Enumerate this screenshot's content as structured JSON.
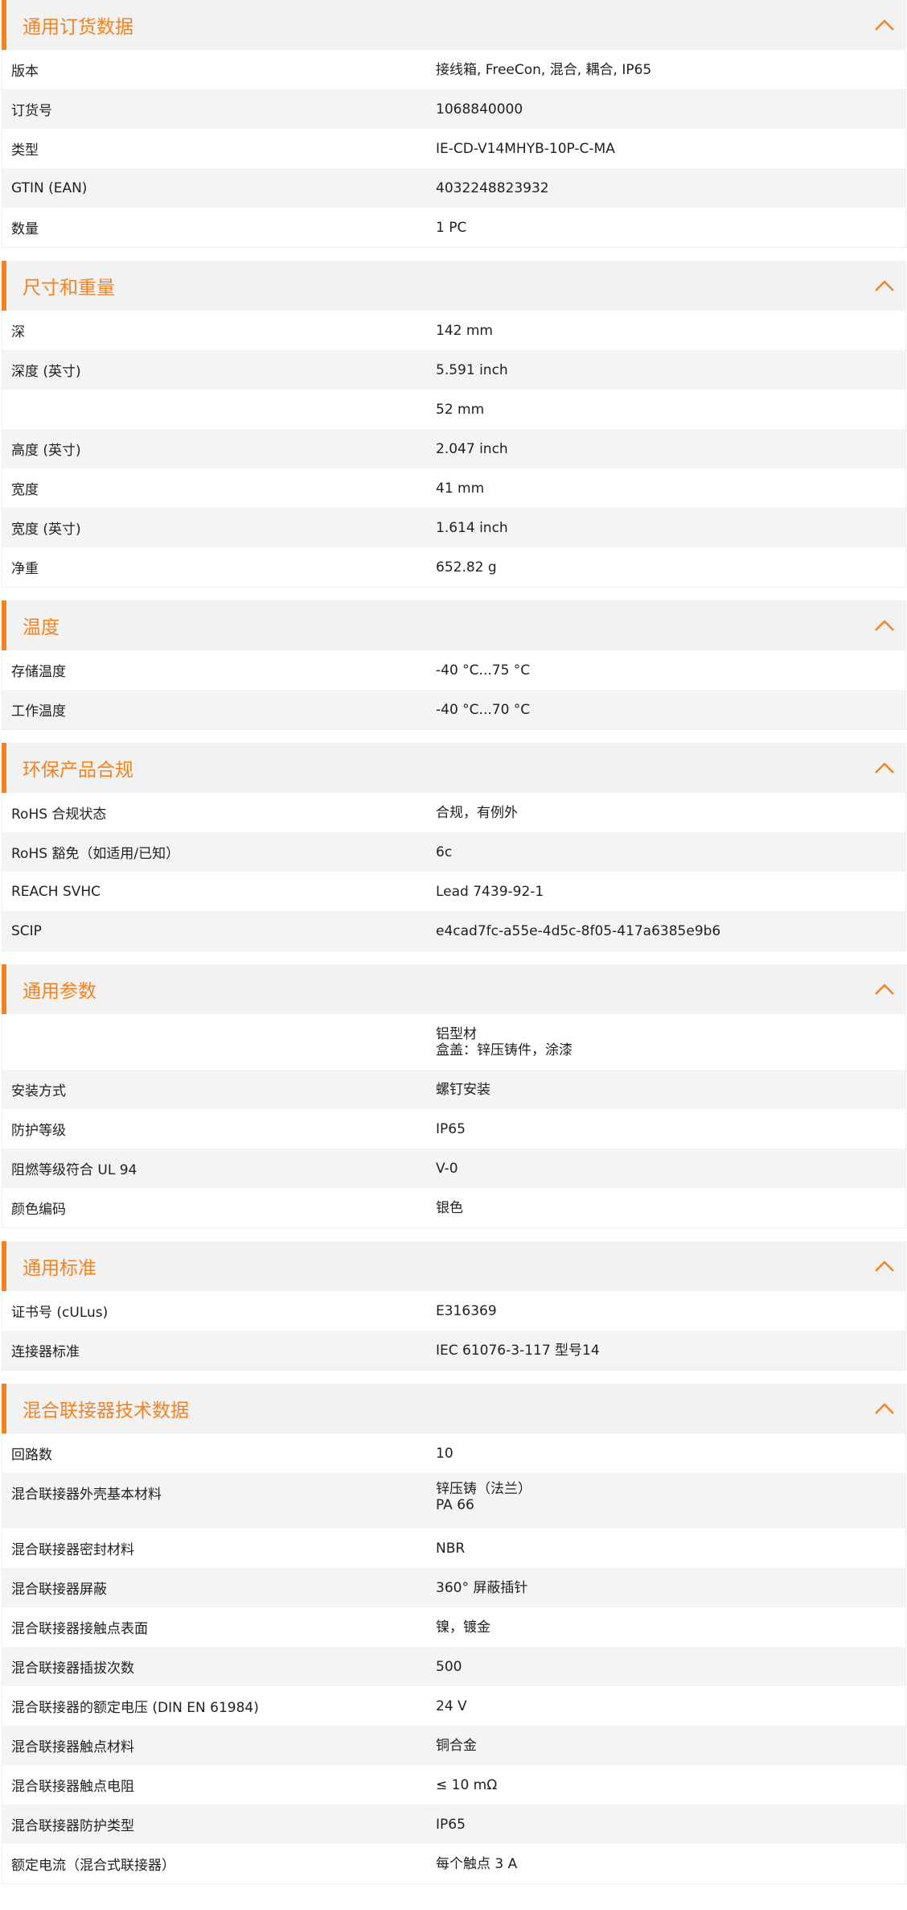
{
  "sections": [
    {
      "title": "通用订货数据",
      "rows": [
        {
          "label": "版本",
          "value": "接线箱, FreeCon, 混合, 耦合, IP65"
        },
        {
          "label": "订货号",
          "value": "1068840000"
        },
        {
          "label": "类型",
          "value": "IE-CD-V14MHYB-10P-C-MA"
        },
        {
          "label": "GTIN (EAN)",
          "value": "4032248823932"
        },
        {
          "label": "数量",
          "value": "1  PC"
        }
      ]
    },
    {
      "title": "尺寸和重量",
      "rows": [
        {
          "label": "深",
          "value": "142  mm"
        },
        {
          "label": "深度 (英寸)",
          "value": "5.591  inch"
        },
        {
          "label": "",
          "value": "52  mm"
        },
        {
          "label": "高度 (英寸)",
          "value": "2.047  inch"
        },
        {
          "label": "宽度",
          "value": "41  mm"
        },
        {
          "label": "宽度 (英寸)",
          "value": "1.614  inch"
        },
        {
          "label": "净重",
          "value": "652.82  g"
        }
      ]
    },
    {
      "title": "温度",
      "rows": [
        {
          "label": "存储温度",
          "value": "-40 °C...75 °C"
        },
        {
          "label": "工作温度",
          "value": "-40 °C...70 °C"
        }
      ]
    },
    {
      "title": "环保产品合规",
      "rows": [
        {
          "label": "RoHS 合规状态",
          "value": "合规，有例外"
        },
        {
          "label": "RoHS 豁免（如适用/已知）",
          "value": "6c"
        },
        {
          "label": "REACH SVHC",
          "value": "Lead 7439-92-1"
        },
        {
          "label": "SCIP",
          "value": "e4cad7fc-a55e-4d5c-8f05-417a6385e9b6"
        }
      ]
    },
    {
      "title": "通用参数",
      "rows": [
        {
          "label": "",
          "value": "铝型材",
          "value2": "盒盖：锌压铸件，涂漆"
        },
        {
          "label": "安装方式",
          "value": "螺钉安装"
        },
        {
          "label": "防护等级",
          "value": "IP65"
        },
        {
          "label": "阻燃等级符合 UL 94",
          "value": "V-0"
        },
        {
          "label": "颜色编码",
          "value": "银色"
        }
      ]
    },
    {
      "title": "通用标准",
      "rows": [
        {
          "label": "证书号 (cULus)",
          "value": "E316369"
        },
        {
          "label": "连接器标准",
          "value": "IEC 61076-3-117 型号14"
        }
      ]
    },
    {
      "title": "混合联接器技术数据",
      "rows": [
        {
          "label": "回路数",
          "value": "10"
        },
        {
          "label": "混合联接器外壳基本材料",
          "value": "锌压铸（法兰）",
          "value2": "PA 66"
        },
        {
          "label": "混合联接器密封材料",
          "value": "NBR"
        },
        {
          "label": "混合联接器屏蔽",
          "value": "360° 屏蔽插针"
        },
        {
          "label": "混合联接器接触点表面",
          "value": "镍，镀金"
        },
        {
          "label": "混合联接器插拔次数",
          "value": "500"
        },
        {
          "label": "混合联接器的额定电压 (DIN EN 61984)",
          "value": "24  V"
        },
        {
          "label": "混合联接器触点材料",
          "value": "铜合金"
        },
        {
          "label": "混合联接器触点电阻",
          "value": "≤ 10 mΩ"
        },
        {
          "label": "混合联接器防护类型",
          "value": "IP65"
        },
        {
          "label": "额定电流（混合式联接器）",
          "value": "每个触点 3 A"
        }
      ]
    }
  ],
  "icons": {
    "toggle": "chevron-up-icon"
  },
  "colors": {
    "accent": "#f58220",
    "header_bg": "#f2f2f2",
    "row_alt_bg": "#f4f4f4"
  }
}
